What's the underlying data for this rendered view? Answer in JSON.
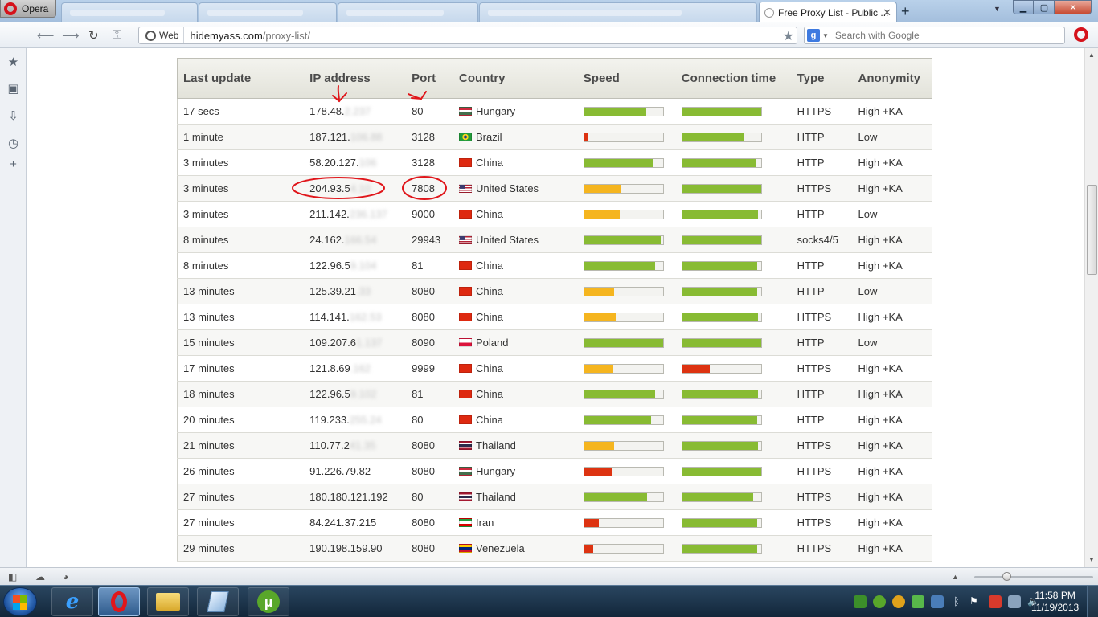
{
  "browser": {
    "menu_label": "Opera",
    "active_tab_title": "Free Proxy List - Public ...",
    "address_badge": "Web",
    "url_host": "hidemyass.com",
    "url_path": "/proxy-list/",
    "search_placeholder": "Search with Google",
    "search_engine_glyph": "g"
  },
  "table": {
    "headers": [
      "Last update",
      "IP address",
      "Port",
      "Country",
      "Speed",
      "Connection time",
      "Type",
      "Anonymity"
    ],
    "rows": [
      {
        "update": "17 secs",
        "ip": "178.48.",
        "ip_hidden": "2.237",
        "port": "80",
        "country": "Hungary",
        "flag": "hu",
        "speed": 0.79,
        "conn": 1.0,
        "speed_color": "#88bb33",
        "conn_color": "#88bb33",
        "type": "HTTPS",
        "anon": "High +KA"
      },
      {
        "update": "1 minute",
        "ip": "187.121.",
        "ip_hidden": "106.88",
        "port": "3128",
        "country": "Brazil",
        "flag": "br",
        "speed": 0.04,
        "conn": 0.78,
        "speed_color": "#dd3311",
        "conn_color": "#88bb33",
        "type": "HTTP",
        "anon": "Low"
      },
      {
        "update": "3 minutes",
        "ip": "58.20.127.",
        "ip_hidden": "106",
        "port": "3128",
        "country": "China",
        "flag": "cn",
        "speed": 0.87,
        "conn": 0.93,
        "speed_color": "#88bb33",
        "conn_color": "#88bb33",
        "type": "HTTP",
        "anon": "High +KA"
      },
      {
        "update": "3 minutes",
        "ip": "204.93.5",
        "ip_hidden": "4.10",
        "port": "7808",
        "country": "United States",
        "flag": "us",
        "speed": 0.46,
        "conn": 1.0,
        "speed_color": "#f5b51f",
        "conn_color": "#88bb33",
        "type": "HTTPS",
        "anon": "High +KA"
      },
      {
        "update": "3 minutes",
        "ip": "211.142.",
        "ip_hidden": "236.137",
        "port": "9000",
        "country": "China",
        "flag": "cn",
        "speed": 0.45,
        "conn": 0.96,
        "speed_color": "#f5b51f",
        "conn_color": "#88bb33",
        "type": "HTTP",
        "anon": "Low"
      },
      {
        "update": "8 minutes",
        "ip": "24.162.",
        "ip_hidden": "166.54",
        "port": "29943",
        "country": "United States",
        "flag": "us",
        "speed": 0.97,
        "conn": 1.0,
        "speed_color": "#88bb33",
        "conn_color": "#88bb33",
        "type": "socks4/5",
        "anon": "High +KA"
      },
      {
        "update": "8 minutes",
        "ip": "122.96.5",
        "ip_hidden": "9.104",
        "port": "81",
        "country": "China",
        "flag": "cn",
        "speed": 0.9,
        "conn": 0.95,
        "speed_color": "#88bb33",
        "conn_color": "#88bb33",
        "type": "HTTP",
        "anon": "High +KA"
      },
      {
        "update": "13 minutes",
        "ip": "125.39.21",
        "ip_hidden": ".33",
        "port": "8080",
        "country": "China",
        "flag": "cn",
        "speed": 0.38,
        "conn": 0.95,
        "speed_color": "#f5b51f",
        "conn_color": "#88bb33",
        "type": "HTTP",
        "anon": "Low"
      },
      {
        "update": "13 minutes",
        "ip": "114.141.",
        "ip_hidden": "162.53",
        "port": "8080",
        "country": "China",
        "flag": "cn",
        "speed": 0.4,
        "conn": 0.96,
        "speed_color": "#f5b51f",
        "conn_color": "#88bb33",
        "type": "HTTPS",
        "anon": "High +KA"
      },
      {
        "update": "15 minutes",
        "ip": "109.207.6",
        "ip_hidden": "1.137",
        "port": "8090",
        "country": "Poland",
        "flag": "pl",
        "speed": 1.0,
        "conn": 1.0,
        "speed_color": "#88bb33",
        "conn_color": "#88bb33",
        "type": "HTTP",
        "anon": "Low"
      },
      {
        "update": "17 minutes",
        "ip": "121.8.69",
        "ip_hidden": ".162",
        "port": "9999",
        "country": "China",
        "flag": "cn",
        "speed": 0.37,
        "conn": 0.35,
        "speed_color": "#f5b51f",
        "conn_color": "#dd3311",
        "type": "HTTPS",
        "anon": "High +KA"
      },
      {
        "update": "18 minutes",
        "ip": "122.96.5",
        "ip_hidden": "9.102",
        "port": "81",
        "country": "China",
        "flag": "cn",
        "speed": 0.9,
        "conn": 0.96,
        "speed_color": "#88bb33",
        "conn_color": "#88bb33",
        "type": "HTTP",
        "anon": "High +KA"
      },
      {
        "update": "20 minutes",
        "ip": "119.233.",
        "ip_hidden": "255.24",
        "port": "80",
        "country": "China",
        "flag": "cn",
        "speed": 0.85,
        "conn": 0.95,
        "speed_color": "#88bb33",
        "conn_color": "#88bb33",
        "type": "HTTP",
        "anon": "High +KA"
      },
      {
        "update": "21 minutes",
        "ip": "110.77.2",
        "ip_hidden": "41.35",
        "port": "8080",
        "country": "Thailand",
        "flag": "th",
        "speed": 0.38,
        "conn": 0.96,
        "speed_color": "#f5b51f",
        "conn_color": "#88bb33",
        "type": "HTTPS",
        "anon": "High +KA"
      },
      {
        "update": "26 minutes",
        "ip": "91.226.79.82",
        "ip_hidden": "",
        "port": "8080",
        "country": "Hungary",
        "flag": "hu",
        "speed": 0.35,
        "conn": 1.0,
        "speed_color": "#dd3311",
        "conn_color": "#88bb33",
        "type": "HTTPS",
        "anon": "High +KA"
      },
      {
        "update": "27 minutes",
        "ip": "180.180.121.192",
        "ip_hidden": "",
        "port": "80",
        "country": "Thailand",
        "flag": "th",
        "speed": 0.8,
        "conn": 0.9,
        "speed_color": "#88bb33",
        "conn_color": "#88bb33",
        "type": "HTTPS",
        "anon": "High +KA"
      },
      {
        "update": "27 minutes",
        "ip": "84.241.37.215",
        "ip_hidden": "",
        "port": "8080",
        "country": "Iran",
        "flag": "ir",
        "speed": 0.19,
        "conn": 0.95,
        "speed_color": "#dd3311",
        "conn_color": "#88bb33",
        "type": "HTTPS",
        "anon": "High +KA"
      },
      {
        "update": "29 minutes",
        "ip": "190.198.159.90",
        "ip_hidden": "",
        "port": "8080",
        "country": "Venezuela",
        "flag": "ve",
        "speed": 0.11,
        "conn": 0.95,
        "speed_color": "#dd3311",
        "conn_color": "#88bb33",
        "type": "HTTPS",
        "anon": "High +KA"
      }
    ]
  },
  "sidebar": {
    "icons": [
      "bookmarks-star-icon",
      "notes-icon",
      "downloads-icon",
      "history-icon",
      "add-panel-icon"
    ]
  },
  "taskbar": {
    "clock_time": "11:58 PM",
    "clock_date": "11/19/2013"
  },
  "colors": {
    "bar_green": "#88bb33",
    "bar_orange": "#f5b51f",
    "bar_red": "#dd3311",
    "annotation_red": "#e0161b"
  }
}
